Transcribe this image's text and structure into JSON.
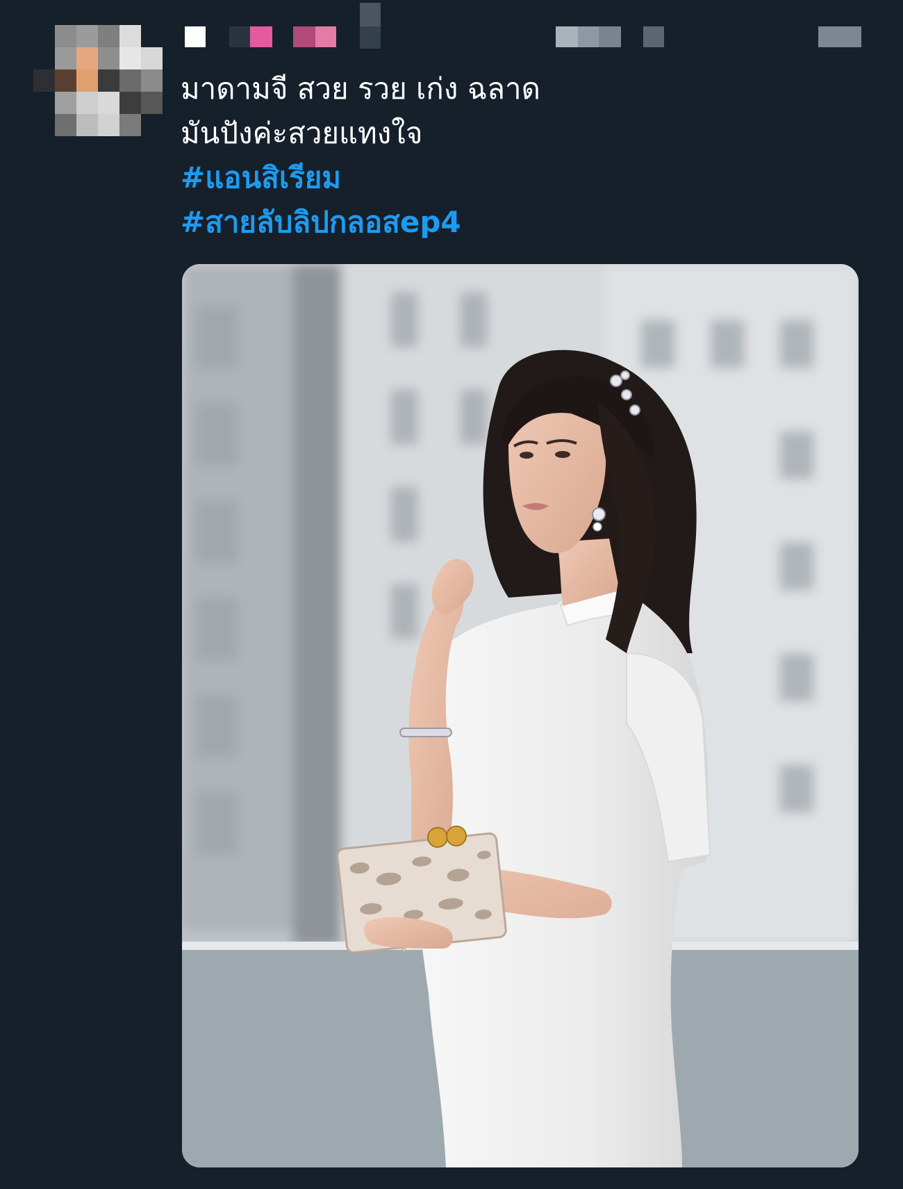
{
  "app": {
    "theme_background": "#15202b",
    "accent": "#1d9bf0"
  },
  "tweet": {
    "author": {
      "avatar": "pixelated-avatar",
      "display_name_redacted": true,
      "handle_redacted": true
    },
    "text_lines": [
      "มาดามจี สวย รวย เก่ง ฉลาด",
      "มันปังค่ะสวยแทงใจ"
    ],
    "hashtags": [
      "#แอนสิเรียม",
      "#สายลับลิปกลอสep4"
    ],
    "media": {
      "type": "photo",
      "subject": "woman-in-white-dress-with-clutch"
    }
  }
}
